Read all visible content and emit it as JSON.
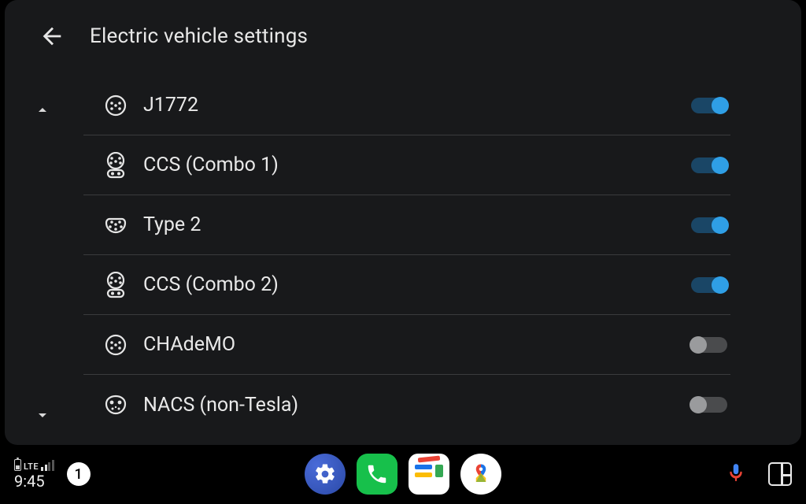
{
  "header": {
    "title": "Electric vehicle settings"
  },
  "plugs": [
    {
      "label": "J1772",
      "on": true,
      "icon": "j1772"
    },
    {
      "label": "CCS (Combo 1)",
      "on": true,
      "icon": "ccs1"
    },
    {
      "label": "Type 2",
      "on": true,
      "icon": "type2"
    },
    {
      "label": "CCS (Combo 2)",
      "on": true,
      "icon": "ccs2"
    },
    {
      "label": "CHAdeMO",
      "on": false,
      "icon": "chademo"
    },
    {
      "label": "NACS (non-Tesla)",
      "on": false,
      "icon": "nacs"
    }
  ],
  "status": {
    "clock": "9:45",
    "network": "LTE",
    "notification_count": "1"
  },
  "colors": {
    "toggle_on": "#2f9fe6",
    "toggle_off": "#9a9b9d",
    "panel_bg": "#18191b"
  }
}
